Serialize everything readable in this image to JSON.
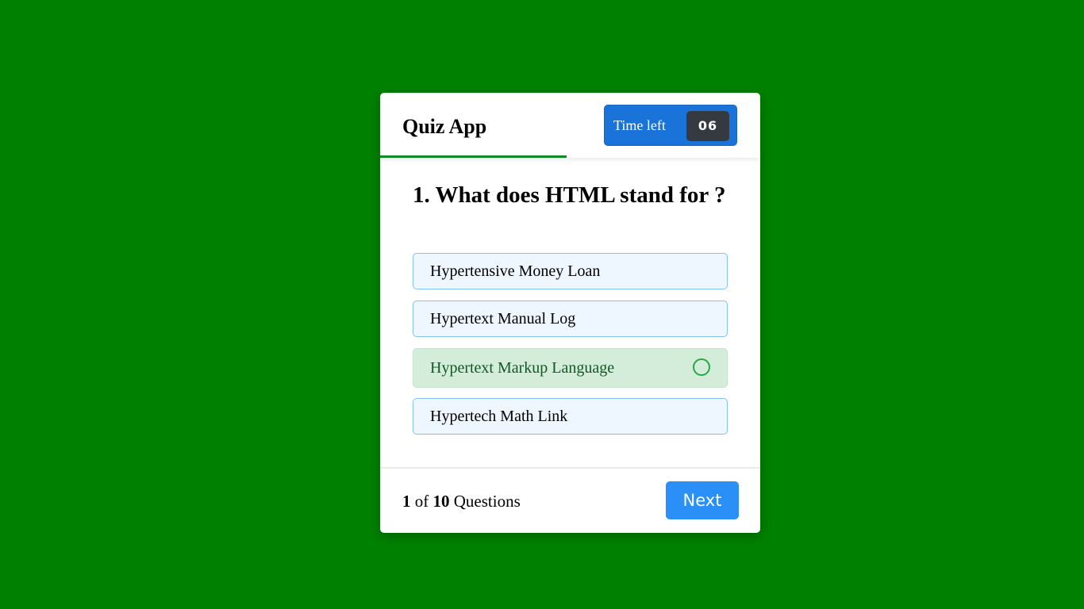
{
  "header": {
    "title": "Quiz App",
    "time_label": "Time left",
    "time_value": "06",
    "timer_progress_fraction": 0.49
  },
  "question": {
    "text": "1. What does HTML stand for ?"
  },
  "options": [
    {
      "label": "Hypertensive Money Loan",
      "state": "default"
    },
    {
      "label": "Hypertext Manual Log",
      "state": "default"
    },
    {
      "label": "Hypertext Markup Language",
      "state": "correct",
      "icon": "circle-check-icon"
    },
    {
      "label": "Hypertech Math Link",
      "state": "default"
    }
  ],
  "footer": {
    "current": "1",
    "of_text": "of",
    "total": "10",
    "suffix": "Questions",
    "next_label": "Next"
  },
  "colors": {
    "background": "#008000",
    "accent": "#1a73d9",
    "correct_bg": "#d4edda",
    "correct_icon": "#28a745",
    "next_button": "#2a8ff7"
  }
}
